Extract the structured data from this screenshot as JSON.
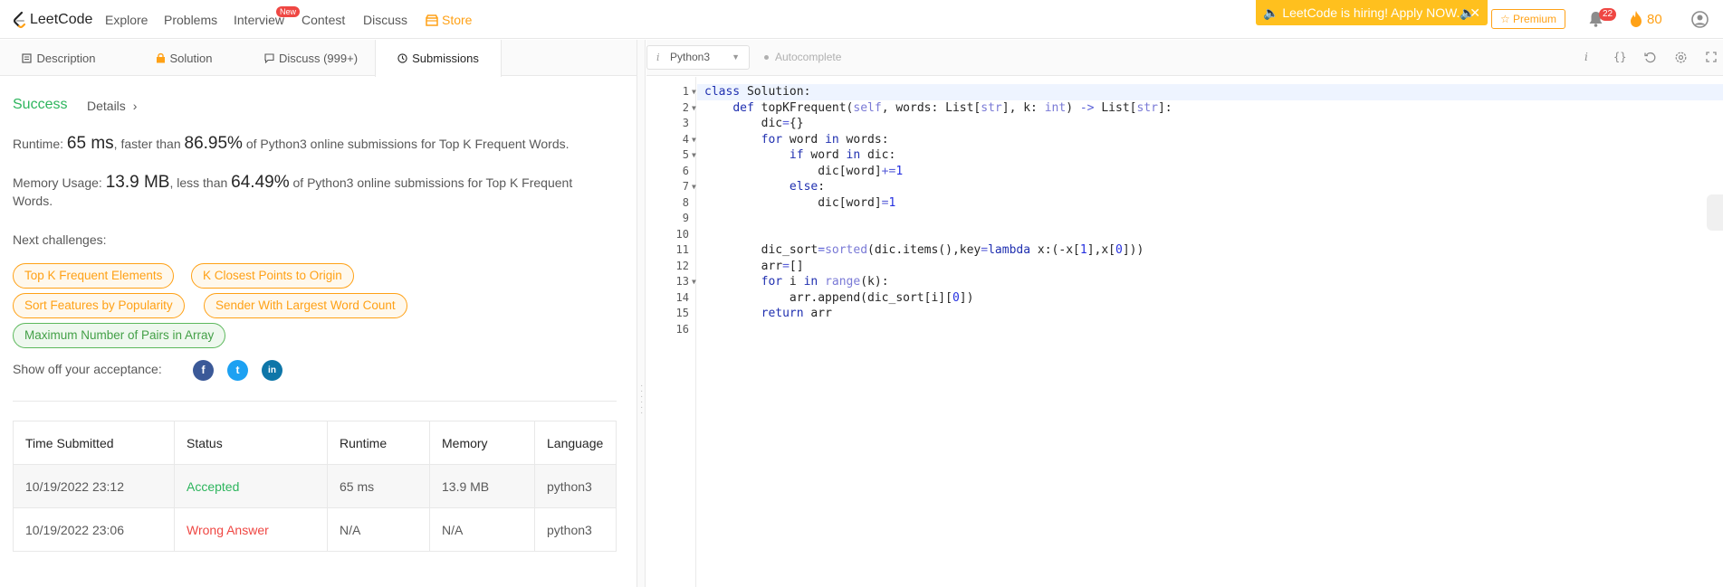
{
  "nav": {
    "logo_text": "LeetCode",
    "links": [
      "Explore",
      "Problems",
      "Interview",
      "Contest",
      "Discuss",
      "Store"
    ],
    "new_badge": "New",
    "hiring_banner": "🔈 LeetCode is hiring! Apply NOW.🔈",
    "hiring_close": "✕",
    "premium_label": "☆ Premium",
    "notification_count": "22",
    "streak_count": "80",
    "accent_color": "#ffa116"
  },
  "tabs": [
    {
      "label": "Description",
      "icon": "description-icon"
    },
    {
      "label": "Solution",
      "icon": "lock-icon"
    },
    {
      "label": "Discuss (999+)",
      "icon": "discuss-icon"
    },
    {
      "label": "Submissions",
      "icon": "clock-icon"
    }
  ],
  "result": {
    "status": "Success",
    "details_label": "Details",
    "runtime_prefix": "Runtime: ",
    "runtime_value": "65 ms",
    "runtime_mid": ", faster than ",
    "runtime_pct": "86.95%",
    "runtime_suffix": " of Python3 online submissions for Top K Frequent Words.",
    "memory_prefix": "Memory Usage: ",
    "memory_value": "13.9 MB",
    "memory_mid": ", less than ",
    "memory_pct": "64.49%",
    "memory_suffix": " of Python3 online submissions for Top K Frequent Words.",
    "next_challenges_label": "Next challenges:",
    "challenges": [
      {
        "label": "Top K Frequent Elements",
        "difficulty": "medium"
      },
      {
        "label": "K Closest Points to Origin",
        "difficulty": "medium"
      },
      {
        "label": "Sort Features by Popularity",
        "difficulty": "medium"
      },
      {
        "label": "Sender With Largest Word Count",
        "difficulty": "medium"
      },
      {
        "label": "Maximum Number of Pairs in Array",
        "difficulty": "easy"
      }
    ],
    "show_off_label": "Show off your acceptance:",
    "social": [
      {
        "name": "facebook",
        "glyph": "f",
        "color": "#3b5998"
      },
      {
        "name": "twitter",
        "glyph": "t",
        "color": "#1da1f2"
      },
      {
        "name": "linkedin",
        "glyph": "in",
        "color": "#0e76a8"
      }
    ]
  },
  "submissions": {
    "headers": [
      "Time Submitted",
      "Status",
      "Runtime",
      "Memory",
      "Language"
    ],
    "rows": [
      {
        "time": "10/19/2022 23:12",
        "status": "Accepted",
        "runtime": "65 ms",
        "memory": "13.9 MB",
        "language": "python3"
      },
      {
        "time": "10/19/2022 23:06",
        "status": "Wrong Answer",
        "runtime": "N/A",
        "memory": "N/A",
        "language": "python3"
      }
    ]
  },
  "editor": {
    "language": "Python3",
    "autocomplete_label": "Autocomplete",
    "toolbar_icons": [
      "info-icon",
      "braces-icon",
      "reset-icon",
      "settings-icon",
      "fullscreen-icon"
    ],
    "folded_lines": [
      1,
      2,
      4,
      5,
      7,
      13
    ],
    "code_lines": [
      "class Solution:",
      "    def topKFrequent(self, words: List[str], k: int) -> List[str]:",
      "        dic={}",
      "        for word in words:",
      "            if word in dic:",
      "                dic[word]+=1",
      "            else:",
      "                dic[word]=1",
      "",
      "",
      "        dic_sort=sorted(dic.items(),key=lambda x:(-x[1],x[0]))",
      "        arr=[]",
      "        for i in range(k):",
      "            arr.append(dic_sort[i][0])",
      "        return arr",
      ""
    ]
  }
}
